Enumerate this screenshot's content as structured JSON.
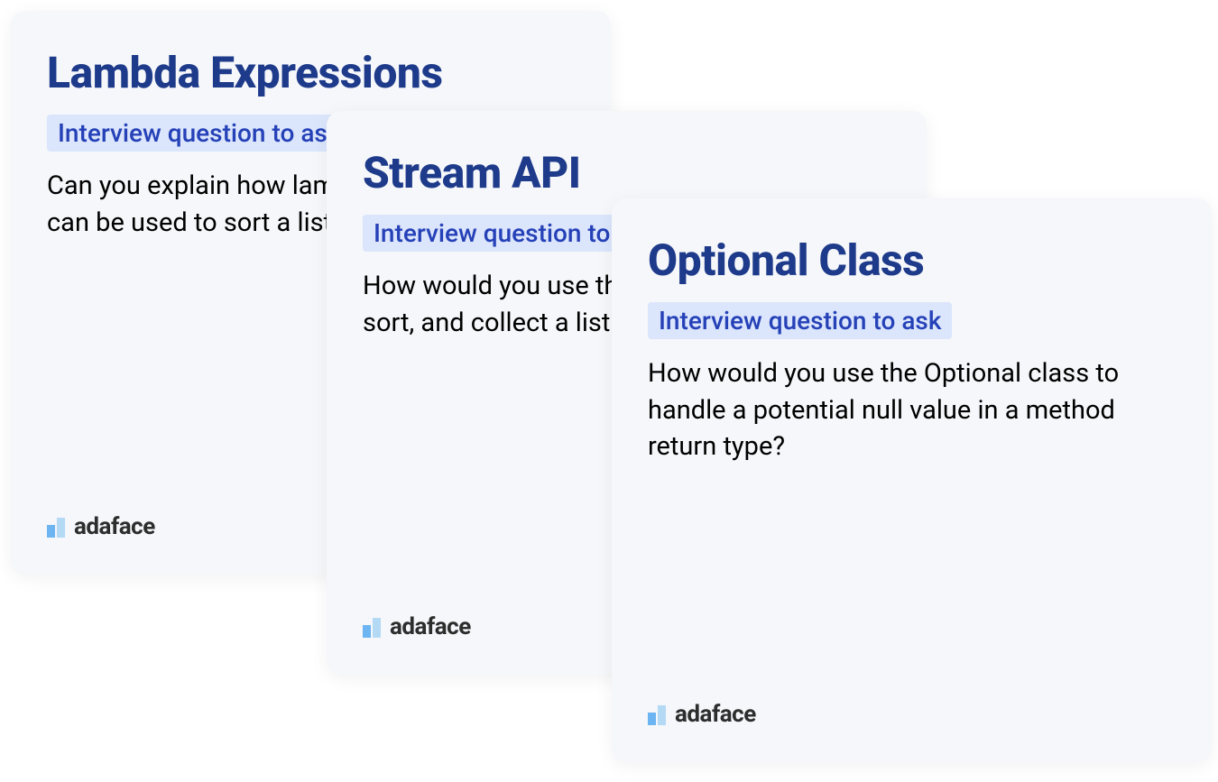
{
  "badge_label": "Interview question to ask",
  "brand": "adaface",
  "cards": [
    {
      "title": "Lambda Expressions",
      "question": "Can you explain how lambda expressions can be used to sort a list of strings in Java 8?"
    },
    {
      "title": "Stream API",
      "question": "How would you use the Stream API to filter, sort, and collect a list of integers?"
    },
    {
      "title": "Optional Class",
      "question": "How would you use the Optional class to handle a potential null value in a method return type?"
    }
  ]
}
